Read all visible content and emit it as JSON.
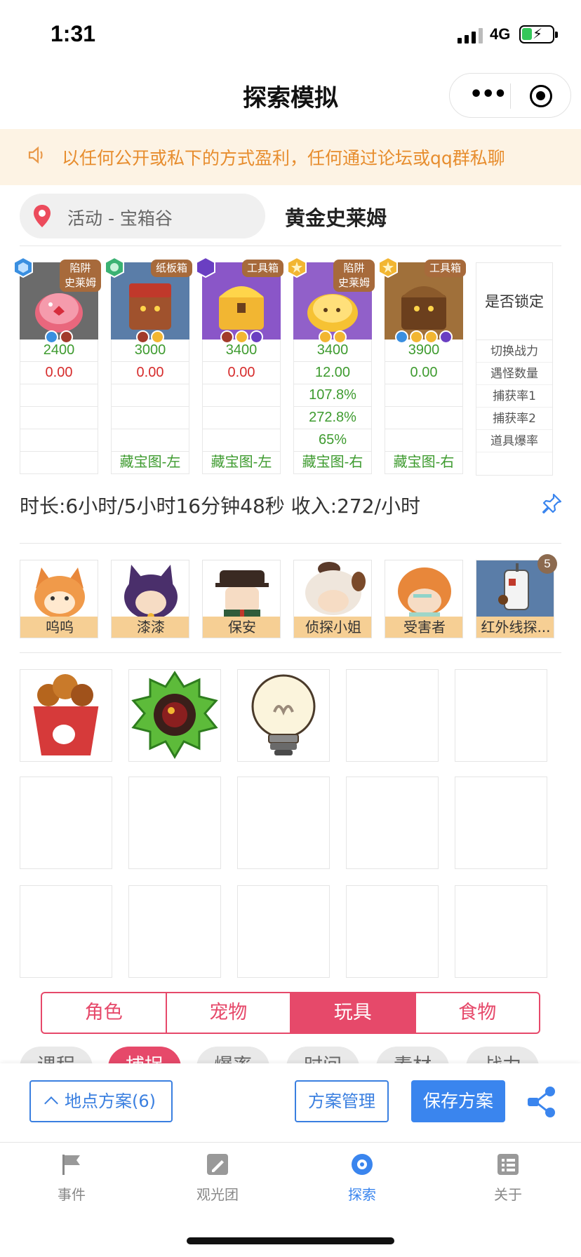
{
  "status": {
    "time": "1:31",
    "network": "4G"
  },
  "nav": {
    "title": "探索模拟"
  },
  "notice": {
    "text": "以任何公开或私下的方式盈利，任何通过论坛或qq群私聊"
  },
  "location": {
    "label": "活动 - 宝箱谷",
    "target": "黄金史莱姆"
  },
  "enemies": [
    {
      "tag": "陷阱\n史莱姆",
      "power": "2400",
      "count": "0.00",
      "capture1": "",
      "capture2": "",
      "drop": "",
      "map": ""
    },
    {
      "tag": "纸板箱",
      "power": "3000",
      "count": "0.00",
      "capture1": "",
      "capture2": "",
      "drop": "",
      "map": "藏宝图-左"
    },
    {
      "tag": "工具箱",
      "power": "3400",
      "count": "0.00",
      "capture1": "",
      "capture2": "",
      "drop": "",
      "map": "藏宝图-左"
    },
    {
      "tag": "陷阱\n史莱姆",
      "power": "3400",
      "count": "12.00",
      "capture1": "107.8%",
      "capture2": "272.8%",
      "drop": "65%",
      "map": "藏宝图-右"
    },
    {
      "tag": "工具箱",
      "power": "3900",
      "count": "0.00",
      "capture1": "",
      "capture2": "",
      "drop": "",
      "map": "藏宝图-右"
    }
  ],
  "stat_labels": {
    "lock": "是否锁定",
    "power": "切换战力",
    "count": "遇怪数量",
    "capture1": "捕获率1",
    "capture2": "捕获率2",
    "drop": "道具爆率"
  },
  "summary": {
    "text": "时长:6小时/5小时16分钟48秒 收入:272/小时"
  },
  "members": [
    {
      "name": "呜呜"
    },
    {
      "name": "漆漆"
    },
    {
      "name": "保安"
    },
    {
      "name": "侦探小姐"
    },
    {
      "name": "受害者"
    },
    {
      "name": "红外线探..."
    }
  ],
  "member_badge": "5",
  "tabs": [
    "角色",
    "宠物",
    "玩具",
    "食物"
  ],
  "active_tab": "玩具",
  "chips": [
    "课程",
    "捕捉",
    "爆率",
    "时间",
    "素材",
    "战力"
  ],
  "actions": {
    "plans": "地点方案(6)",
    "manage": "方案管理",
    "save": "保存方案"
  },
  "tabbar": [
    {
      "label": "事件",
      "icon": "flag-icon"
    },
    {
      "label": "观光团",
      "icon": "edit-icon"
    },
    {
      "label": "探索",
      "icon": "explore-icon"
    },
    {
      "label": "关于",
      "icon": "list-icon"
    }
  ],
  "colors": {
    "accent_red": "#e6496a",
    "accent_blue": "#3a85ee",
    "notice_text": "#e78d2e",
    "member_label_bg": "#f6cf94"
  }
}
